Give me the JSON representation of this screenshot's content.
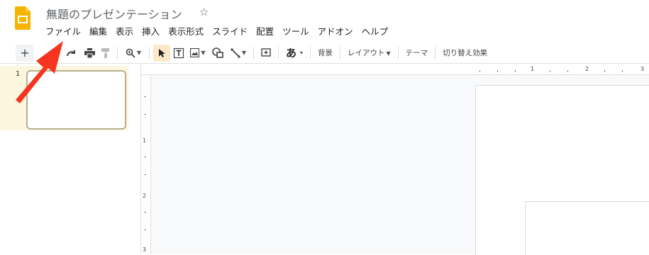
{
  "header": {
    "title": "無題のプレゼンテーション",
    "star_icon": "star-outline-icon",
    "logo_icon": "slides-logo-icon",
    "logo_color": "#f4b400"
  },
  "menubar": {
    "items": [
      "ファイル",
      "編集",
      "表示",
      "挿入",
      "表示形式",
      "スライド",
      "配置",
      "ツール",
      "アドオン",
      "ヘルプ"
    ]
  },
  "toolbar": {
    "new_slide": "+",
    "text_glyph": "あ",
    "background_label": "背景",
    "layout_label": "レイアウト",
    "theme_label": "テーマ",
    "transition_label": "切り替え効果",
    "icons": [
      "plus-icon",
      "undo-icon",
      "redo-icon",
      "print-icon",
      "paint-format-icon",
      "zoom-icon",
      "select-cursor-icon",
      "text-box-icon",
      "image-icon",
      "shape-icon",
      "line-icon",
      "comment-icon"
    ],
    "active_tool_bg": "#fde9c8"
  },
  "filmstrip": {
    "slide_number": "1",
    "selected_bg": "#fdf6df"
  },
  "rulers": {
    "top_numbers": [
      "1",
      "2",
      "3"
    ],
    "left_numbers": [
      "1",
      "2",
      "3"
    ]
  },
  "annotation": {
    "arrow_color": "#f5351f"
  }
}
